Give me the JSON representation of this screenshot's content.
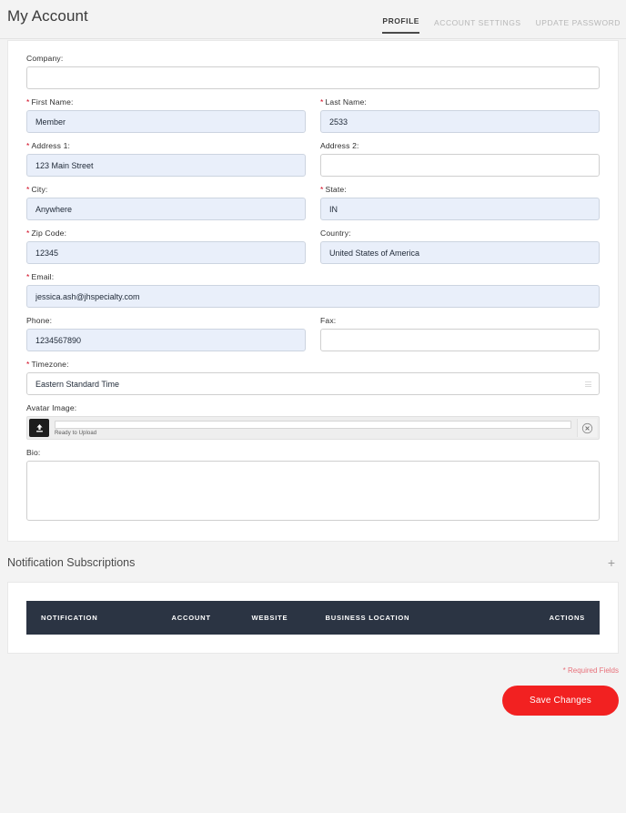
{
  "header": {
    "title": "My Account",
    "tabs": [
      {
        "label": "PROFILE",
        "active": true
      },
      {
        "label": "ACCOUNT SETTINGS",
        "active": false
      },
      {
        "label": "UPDATE PASSWORD",
        "active": false
      }
    ]
  },
  "form": {
    "company": {
      "label": "Company:",
      "required": false,
      "value": ""
    },
    "first_name": {
      "label": "First Name:",
      "required": true,
      "value": "Member"
    },
    "last_name": {
      "label": "Last Name:",
      "required": true,
      "value": "2533"
    },
    "address1": {
      "label": "Address 1:",
      "required": true,
      "value": "123 Main Street"
    },
    "address2": {
      "label": "Address 2:",
      "required": false,
      "value": ""
    },
    "city": {
      "label": "City:",
      "required": true,
      "value": "Anywhere"
    },
    "state": {
      "label": "State:",
      "required": true,
      "value": "IN"
    },
    "zip": {
      "label": "Zip Code:",
      "required": true,
      "value": "12345"
    },
    "country": {
      "label": "Country:",
      "required": false,
      "value": "United States of America"
    },
    "email": {
      "label": "Email:",
      "required": true,
      "value": "jessica.ash@jhspecialty.com"
    },
    "phone": {
      "label": "Phone:",
      "required": false,
      "value": "1234567890"
    },
    "fax": {
      "label": "Fax:",
      "required": false,
      "value": ""
    },
    "timezone": {
      "label": "Timezone:",
      "required": true,
      "value": "Eastern Standard Time"
    },
    "avatar": {
      "label": "Avatar Image:",
      "filename": "",
      "status": "Ready to Upload"
    },
    "bio": {
      "label": "Bio:",
      "required": false,
      "value": ""
    }
  },
  "notifications": {
    "title": "Notification Subscriptions",
    "expand_icon": "+",
    "columns": [
      "NOTIFICATION",
      "ACCOUNT",
      "WEBSITE",
      "BUSINESS LOCATION",
      "ACTIONS"
    ],
    "rows": []
  },
  "footer": {
    "required_note": "* Required Fields",
    "save_label": "Save Changes"
  },
  "colors": {
    "accent_red": "#f22121",
    "required_red": "#d0021b",
    "table_header": "#2b3443",
    "filled_input_bg": "#e9effa",
    "page_bg": "#f3f3f3"
  }
}
